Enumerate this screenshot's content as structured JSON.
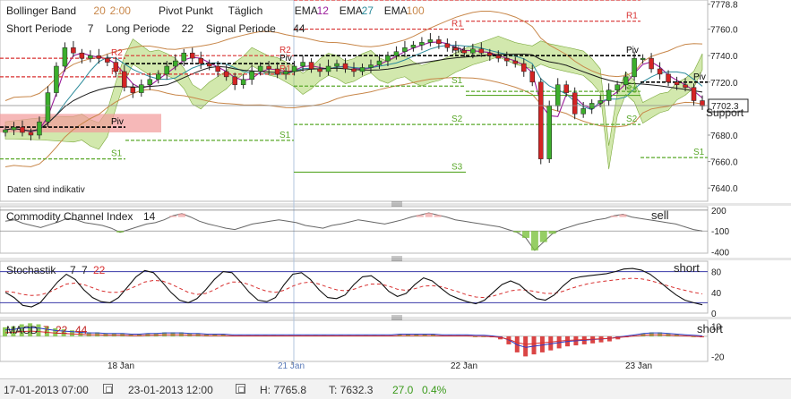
{
  "legend": {
    "bollinger": {
      "name": "Bollinger Band",
      "p1": "20",
      "p2": "2:00",
      "color": "#c8874a"
    },
    "pivot": {
      "name": "Pivot Punkt",
      "mode": "Täglich"
    },
    "ema": [
      {
        "name": "EMA",
        "period": "12",
        "color": "#9b1b9b"
      },
      {
        "name": "EMA",
        "period": "27",
        "color": "#2a8a9a"
      },
      {
        "name": "EMA",
        "period": "100",
        "color": "#c8874a"
      }
    ],
    "ichimoku": [
      {
        "name": "Short Periode",
        "value": "7"
      },
      {
        "name": "Long Periode",
        "value": "22"
      },
      {
        "name": "Signal Periode",
        "value": "44"
      }
    ],
    "disclaimer": "Daten sind indikativ"
  },
  "chart_data": [
    {
      "type": "candlestick",
      "x_ticks": [
        "18 Jan",
        "21 Jan",
        "22 Jan",
        "23 Jan"
      ],
      "ylim": [
        7630,
        7782
      ],
      "y_ticks": [
        7640.0,
        7660.0,
        7680.0,
        7700.0,
        7720.0,
        7740.0,
        7760.0,
        7778.8
      ],
      "last_price_label": "7702.3",
      "current_price": 7702.3,
      "annotations": [
        "Support"
      ],
      "pivot_labels": {
        "R2": "R2",
        "R1": "R1",
        "Piv": "Piv",
        "S1": "S1",
        "S2": "S2",
        "S3": "S3"
      },
      "closes": [
        7684,
        7686,
        7682,
        7680,
        7690,
        7712,
        7732,
        7746,
        7742,
        7738,
        7740,
        7738,
        7735,
        7728,
        7716,
        7712,
        7718,
        7722,
        7726,
        7732,
        7736,
        7742,
        7738,
        7734,
        7732,
        7728,
        7724,
        7718,
        7722,
        7728,
        7732,
        7730,
        7726,
        7728,
        7732,
        7735,
        7730,
        7728,
        7732,
        7734,
        7730,
        7728,
        7731,
        7733,
        7736,
        7740,
        7743,
        7746,
        7748,
        7750,
        7752,
        7749,
        7746,
        7744,
        7742,
        7745,
        7742,
        7740,
        7738,
        7736,
        7734,
        7728,
        7720,
        7662,
        7702,
        7718,
        7712,
        7696,
        7700,
        7704,
        7706,
        7714,
        7718,
        7724,
        7738,
        7738,
        7730,
        7726,
        7720,
        7718,
        7716,
        7706,
        7702
      ]
    },
    {
      "type": "line",
      "title": "Commodity Channel Index",
      "period": "14",
      "y_ticks": [
        "200",
        "-100",
        "-400"
      ],
      "ylim": [
        -420,
        250
      ],
      "signal": "sell",
      "values": [
        40,
        60,
        10,
        -20,
        -50,
        -10,
        30,
        80,
        60,
        20,
        0,
        -20,
        -60,
        -120,
        -80,
        -40,
        0,
        20,
        60,
        120,
        150,
        100,
        40,
        0,
        -30,
        -60,
        -80,
        -40,
        0,
        20,
        40,
        60,
        40,
        20,
        -20,
        -40,
        -60,
        -20,
        0,
        30,
        60,
        40,
        20,
        0,
        30,
        60,
        100,
        130,
        160,
        130,
        100,
        60,
        40,
        20,
        0,
        -20,
        -40,
        -80,
        -120,
        -200,
        -380,
        -260,
        -140,
        -80,
        -40,
        0,
        30,
        60,
        80,
        120,
        140,
        100,
        80,
        60,
        40,
        20,
        0,
        -40,
        -80,
        -100
      ]
    },
    {
      "type": "line",
      "title": "Stochastik",
      "params": [
        "7",
        "7"
      ],
      "signal_param": "22",
      "y_ticks": [
        "80",
        "40",
        "0"
      ],
      "ylim": [
        0,
        100
      ],
      "signal": "short",
      "k": [
        40,
        30,
        15,
        12,
        20,
        40,
        60,
        75,
        65,
        45,
        30,
        22,
        20,
        30,
        50,
        70,
        82,
        78,
        60,
        40,
        25,
        20,
        28,
        45,
        65,
        80,
        78,
        60,
        40,
        25,
        22,
        30,
        55,
        75,
        78,
        65,
        45,
        30,
        28,
        35,
        55,
        70,
        72,
        60,
        42,
        32,
        38,
        55,
        68,
        62,
        48,
        35,
        28,
        22,
        18,
        25,
        40,
        55,
        62,
        55,
        40,
        28,
        25,
        35,
        52,
        66,
        70,
        72,
        74,
        76,
        80,
        85,
        86,
        83,
        75,
        62,
        48,
        35,
        25,
        20,
        16
      ],
      "d": [
        42,
        40,
        36,
        34,
        35,
        40,
        48,
        56,
        58,
        55,
        49,
        43,
        40,
        40,
        45,
        52,
        60,
        63,
        62,
        56,
        48,
        40,
        36,
        38,
        45,
        54,
        60,
        60,
        55,
        48,
        42,
        40,
        44,
        52,
        58,
        60,
        56,
        50,
        45,
        43,
        46,
        52,
        56,
        56,
        52,
        46,
        44,
        47,
        52,
        53,
        51,
        46,
        41,
        35,
        31,
        30,
        33,
        38,
        43,
        45,
        44,
        41,
        38,
        38,
        42,
        48,
        53,
        57,
        60,
        62,
        64,
        66,
        67,
        66,
        63,
        58,
        53,
        48,
        44,
        40,
        37
      ]
    },
    {
      "type": "bar",
      "title": "MACD",
      "params": [
        "7",
        "22",
        "44"
      ],
      "y_ticks": [
        "10",
        "-20"
      ],
      "ylim": [
        -25,
        16
      ],
      "signal": "short",
      "hist": [
        9,
        10,
        12,
        13,
        12,
        10,
        8,
        7,
        6,
        5,
        4,
        4,
        3,
        3,
        3,
        2,
        2,
        3,
        3,
        4,
        4,
        4,
        3,
        3,
        2,
        2,
        2,
        1,
        1,
        1,
        1,
        1,
        1,
        1,
        1,
        1,
        1,
        1,
        1,
        1,
        1,
        1,
        1,
        1,
        1,
        1,
        1,
        2,
        2,
        2,
        2,
        2,
        1,
        1,
        1,
        1,
        0,
        0,
        -1,
        -3,
        -8,
        -16,
        -20,
        -18,
        -16,
        -14,
        -12,
        -10,
        -9,
        -8,
        -7,
        -6,
        -5,
        -3,
        -1,
        1,
        3,
        4,
        4,
        3,
        2,
        1,
        0,
        -1
      ]
    }
  ],
  "footer": {
    "from": "17-01-2013 07:00",
    "to": "23-01-2013 12:00",
    "high": "H: 7765.8",
    "low": "T: 7632.3",
    "change": "27.0",
    "change_pct": "0.4%"
  }
}
